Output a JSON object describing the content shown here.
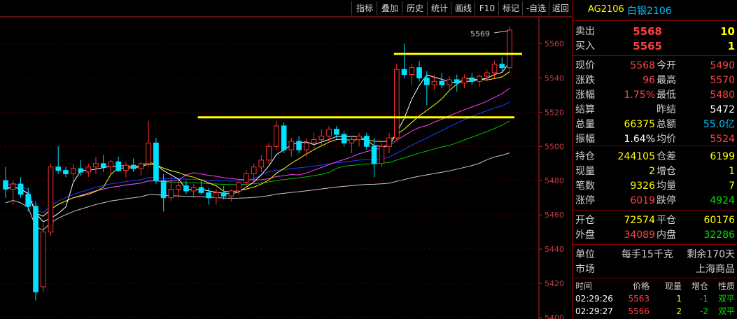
{
  "toolbar": {
    "buttons": [
      "指标",
      "叠加",
      "历史",
      "统计",
      "画线",
      "F10",
      "标记",
      "-自选",
      "返回"
    ]
  },
  "chart": {
    "price_axis": [
      "5560",
      "5540",
      "5520",
      "5500",
      "5480",
      "5460",
      "5440",
      "5420",
      "5400"
    ],
    "high_marker": "5569",
    "colors": {
      "up": "#ff3030",
      "down": "#00e0ff",
      "ma5": "#ffffff",
      "ma10": "#ffff00",
      "ma20": "#ff40ff",
      "ma40": "#2040ff",
      "ma60": "#00c000",
      "ma120": "#c8c8c8",
      "line": "#ffff00",
      "axis": "#c02020"
    }
  },
  "chart_data": {
    "type": "candlestick",
    "ylim": [
      5400,
      5570
    ],
    "candles": [
      {
        "o": 5480,
        "h": 5488,
        "l": 5470,
        "c": 5475
      },
      {
        "o": 5475,
        "h": 5480,
        "l": 5466,
        "c": 5478
      },
      {
        "o": 5478,
        "h": 5482,
        "l": 5470,
        "c": 5472
      },
      {
        "o": 5472,
        "h": 5476,
        "l": 5462,
        "c": 5465
      },
      {
        "o": 5465,
        "h": 5468,
        "l": 5410,
        "c": 5415
      },
      {
        "o": 5418,
        "h": 5455,
        "l": 5415,
        "c": 5450
      },
      {
        "o": 5450,
        "h": 5490,
        "l": 5448,
        "c": 5488
      },
      {
        "o": 5488,
        "h": 5500,
        "l": 5484,
        "c": 5486
      },
      {
        "o": 5486,
        "h": 5488,
        "l": 5482,
        "c": 5484
      },
      {
        "o": 5484,
        "h": 5490,
        "l": 5480,
        "c": 5487
      },
      {
        "o": 5487,
        "h": 5492,
        "l": 5483,
        "c": 5485
      },
      {
        "o": 5485,
        "h": 5490,
        "l": 5482,
        "c": 5488
      },
      {
        "o": 5488,
        "h": 5494,
        "l": 5484,
        "c": 5490
      },
      {
        "o": 5490,
        "h": 5495,
        "l": 5485,
        "c": 5488
      },
      {
        "o": 5488,
        "h": 5492,
        "l": 5484,
        "c": 5491
      },
      {
        "o": 5491,
        "h": 5494,
        "l": 5485,
        "c": 5486
      },
      {
        "o": 5486,
        "h": 5491,
        "l": 5482,
        "c": 5489
      },
      {
        "o": 5489,
        "h": 5493,
        "l": 5485,
        "c": 5487
      },
      {
        "o": 5487,
        "h": 5491,
        "l": 5483,
        "c": 5490
      },
      {
        "o": 5490,
        "h": 5515,
        "l": 5488,
        "c": 5502
      },
      {
        "o": 5502,
        "h": 5505,
        "l": 5478,
        "c": 5480
      },
      {
        "o": 5480,
        "h": 5484,
        "l": 5462,
        "c": 5470
      },
      {
        "o": 5470,
        "h": 5482,
        "l": 5468,
        "c": 5475
      },
      {
        "o": 5475,
        "h": 5480,
        "l": 5470,
        "c": 5477
      },
      {
        "o": 5477,
        "h": 5480,
        "l": 5472,
        "c": 5474
      },
      {
        "o": 5474,
        "h": 5478,
        "l": 5470,
        "c": 5476
      },
      {
        "o": 5476,
        "h": 5480,
        "l": 5472,
        "c": 5473
      },
      {
        "o": 5473,
        "h": 5476,
        "l": 5466,
        "c": 5470
      },
      {
        "o": 5470,
        "h": 5475,
        "l": 5466,
        "c": 5473
      },
      {
        "o": 5473,
        "h": 5477,
        "l": 5469,
        "c": 5471
      },
      {
        "o": 5471,
        "h": 5475,
        "l": 5468,
        "c": 5474
      },
      {
        "o": 5474,
        "h": 5480,
        "l": 5472,
        "c": 5479
      },
      {
        "o": 5479,
        "h": 5486,
        "l": 5476,
        "c": 5484
      },
      {
        "o": 5484,
        "h": 5490,
        "l": 5480,
        "c": 5488
      },
      {
        "o": 5488,
        "h": 5495,
        "l": 5485,
        "c": 5492
      },
      {
        "o": 5492,
        "h": 5502,
        "l": 5490,
        "c": 5500
      },
      {
        "o": 5500,
        "h": 5515,
        "l": 5498,
        "c": 5512
      },
      {
        "o": 5512,
        "h": 5514,
        "l": 5496,
        "c": 5498
      },
      {
        "o": 5498,
        "h": 5505,
        "l": 5494,
        "c": 5503
      },
      {
        "o": 5503,
        "h": 5506,
        "l": 5496,
        "c": 5498
      },
      {
        "o": 5498,
        "h": 5505,
        "l": 5494,
        "c": 5502
      },
      {
        "o": 5502,
        "h": 5508,
        "l": 5498,
        "c": 5504
      },
      {
        "o": 5504,
        "h": 5510,
        "l": 5500,
        "c": 5506
      },
      {
        "o": 5506,
        "h": 5512,
        "l": 5502,
        "c": 5510
      },
      {
        "o": 5510,
        "h": 5512,
        "l": 5504,
        "c": 5507
      },
      {
        "o": 5507,
        "h": 5509,
        "l": 5500,
        "c": 5502
      },
      {
        "o": 5502,
        "h": 5506,
        "l": 5496,
        "c": 5504
      },
      {
        "o": 5504,
        "h": 5508,
        "l": 5500,
        "c": 5506
      },
      {
        "o": 5506,
        "h": 5508,
        "l": 5498,
        "c": 5500
      },
      {
        "o": 5500,
        "h": 5505,
        "l": 5482,
        "c": 5490
      },
      {
        "o": 5490,
        "h": 5502,
        "l": 5488,
        "c": 5500
      },
      {
        "o": 5500,
        "h": 5508,
        "l": 5496,
        "c": 5505
      },
      {
        "o": 5505,
        "h": 5548,
        "l": 5503,
        "c": 5545
      },
      {
        "o": 5545,
        "h": 5560,
        "l": 5540,
        "c": 5542
      },
      {
        "o": 5542,
        "h": 5548,
        "l": 5536,
        "c": 5546
      },
      {
        "o": 5546,
        "h": 5550,
        "l": 5538,
        "c": 5540
      },
      {
        "o": 5540,
        "h": 5544,
        "l": 5524,
        "c": 5536
      },
      {
        "o": 5536,
        "h": 5542,
        "l": 5533,
        "c": 5538
      },
      {
        "o": 5538,
        "h": 5543,
        "l": 5534,
        "c": 5536
      },
      {
        "o": 5536,
        "h": 5541,
        "l": 5532,
        "c": 5539
      },
      {
        "o": 5539,
        "h": 5542,
        "l": 5532,
        "c": 5537
      },
      {
        "o": 5537,
        "h": 5542,
        "l": 5534,
        "c": 5540
      },
      {
        "o": 5540,
        "h": 5543,
        "l": 5536,
        "c": 5538
      },
      {
        "o": 5538,
        "h": 5542,
        "l": 5535,
        "c": 5541
      },
      {
        "o": 5541,
        "h": 5545,
        "l": 5538,
        "c": 5543
      },
      {
        "o": 5543,
        "h": 5550,
        "l": 5540,
        "c": 5548
      },
      {
        "o": 5548,
        "h": 5552,
        "l": 5544,
        "c": 5546
      },
      {
        "o": 5546,
        "h": 5570,
        "l": 5544,
        "c": 5568
      }
    ],
    "hlines": [
      5554,
      5517
    ]
  },
  "panel": {
    "code": "AG2106",
    "name": "白银2106",
    "ask": {
      "label": "卖出",
      "price": "5568",
      "vol": "10"
    },
    "bid": {
      "label": "买入",
      "price": "5565",
      "vol": "1"
    },
    "stats": [
      {
        "l1": "现价",
        "v1": "5568",
        "c1": "red",
        "l2": "今开",
        "v2": "5490",
        "c2": "red"
      },
      {
        "l1": "涨跌",
        "v1": "96",
        "c1": "red",
        "l2": "最高",
        "v2": "5570",
        "c2": "red"
      },
      {
        "l1": "涨幅",
        "v1": "1.75%",
        "c1": "red",
        "l2": "最低",
        "v2": "5480",
        "c2": "red"
      },
      {
        "l1": "结算",
        "v1": "",
        "c1": "white",
        "l2": "昨结",
        "v2": "5472",
        "c2": "white"
      },
      {
        "l1": "总量",
        "v1": "66375",
        "c1": "yellow",
        "l2": "总额",
        "v2": "55.0亿",
        "c2": "cyan"
      },
      {
        "l1": "振幅",
        "v1": "1.64%",
        "c1": "white",
        "l2": "均价",
        "v2": "5524",
        "c2": "red"
      }
    ],
    "stats2": [
      {
        "l1": "持仓",
        "v1": "244105",
        "c1": "yellow",
        "l2": "仓差",
        "v2": "6199",
        "c2": "yellow"
      },
      {
        "l1": "现量",
        "v1": "2",
        "c1": "yellow",
        "l2": "增仓",
        "v2": "1",
        "c2": "yellow"
      },
      {
        "l1": "笔数",
        "v1": "9326",
        "c1": "yellow",
        "l2": "均量",
        "v2": "7",
        "c2": "yellow"
      },
      {
        "l1": "涨停",
        "v1": "6019",
        "c1": "red",
        "l2": "跌停",
        "v2": "4924",
        "c2": "green"
      }
    ],
    "stats3": [
      {
        "l1": "开仓",
        "v1": "72574",
        "c1": "yellow",
        "l2": "平仓",
        "v2": "60176",
        "c2": "yellow"
      },
      {
        "l1": "外盘",
        "v1": "34089",
        "c1": "red",
        "l2": "内盘",
        "v2": "32286",
        "c2": "green"
      }
    ],
    "unit_label": "单位",
    "unit_value": "每手15千克",
    "remain": "剩余170天",
    "market_label": "市场",
    "market_value": "上海商品",
    "trade_headers": [
      "时间",
      "价格",
      "现量",
      "增仓",
      "性质"
    ],
    "trades": [
      {
        "time": "02:29:26",
        "price": "5563",
        "vol": "1",
        "oi": "-1",
        "type": "双平"
      },
      {
        "time": "02:29:27",
        "price": "5566",
        "vol": "2",
        "oi": "-2",
        "type": "双平"
      }
    ]
  }
}
